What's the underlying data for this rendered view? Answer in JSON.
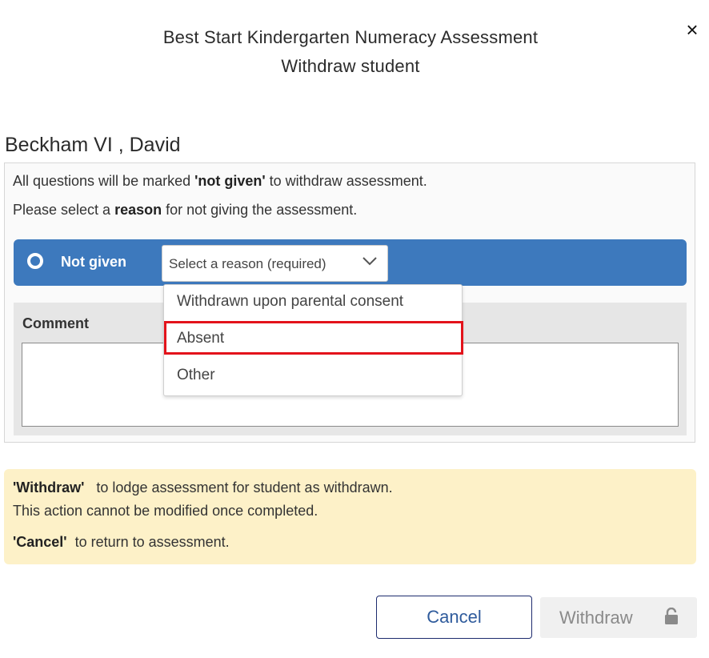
{
  "dialog": {
    "title_line1": "Best Start Kindergarten Numeracy Assessment",
    "title_line2": "Withdraw student",
    "close_icon": "close-icon",
    "close_glyph": "×"
  },
  "student": {
    "name": "Beckham VI , David"
  },
  "instructions": {
    "line1_pre": "All questions will be marked ",
    "line1_bold": "'not given'",
    "line1_post": " to withdraw assessment.",
    "line2_pre": "Please select a ",
    "line2_bold": "reason",
    "line2_post": " for not giving the assessment."
  },
  "reason_row": {
    "radio_label": "Not given",
    "select_placeholder": "Select a reason (required)",
    "chevron_icon": "chevron-down-icon",
    "options": [
      "Withdrawn upon parental consent",
      "Absent",
      "Other"
    ],
    "highlighted_option": "Absent",
    "colors": {
      "bar": "#3d79bd",
      "highlight_border": "#e3131b"
    }
  },
  "comment": {
    "label": "Comment",
    "value": ""
  },
  "notice": {
    "line1_bold": "'Withdraw'",
    "line1_post": "   to lodge assessment for student as withdrawn.",
    "line2": "This action cannot be modified once completed.",
    "line3_bold": "'Cancel'",
    "line3_post": "  to return to assessment.",
    "background": "#fdf1c8"
  },
  "buttons": {
    "cancel_label": "Cancel",
    "withdraw_label": "Withdraw",
    "withdraw_icon": "lock-icon",
    "withdraw_disabled": true
  }
}
